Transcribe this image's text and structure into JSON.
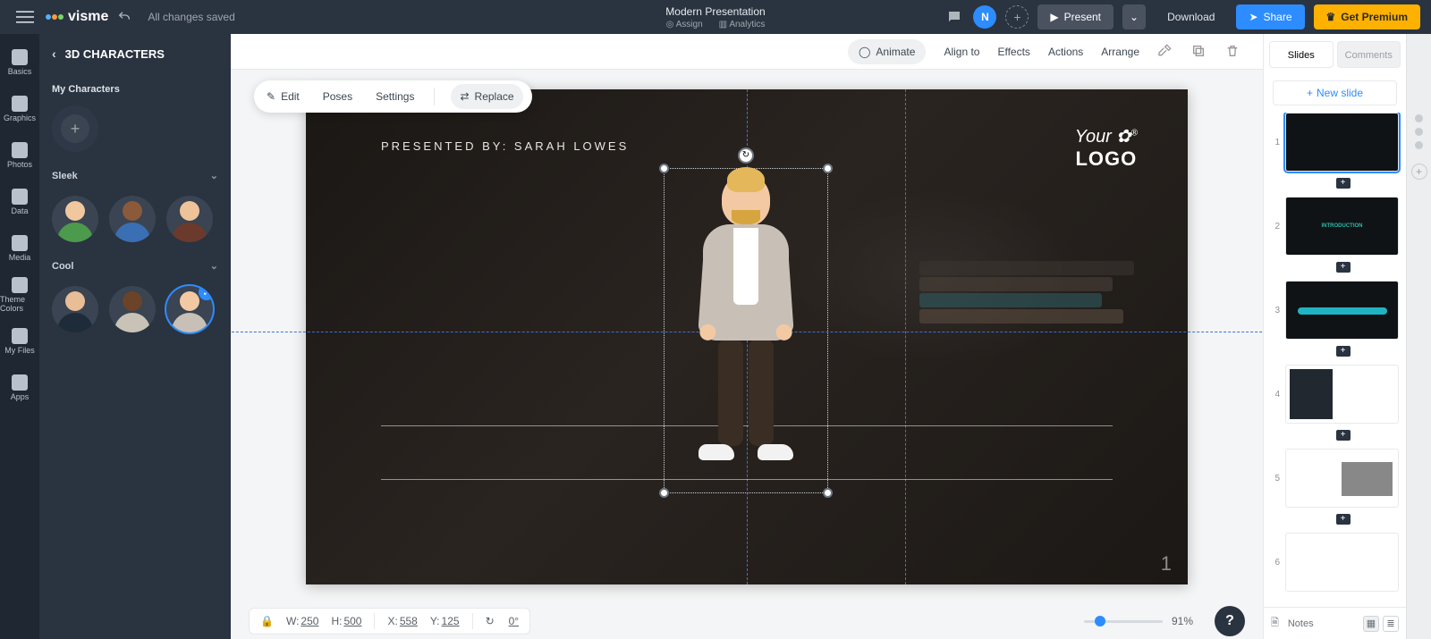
{
  "top": {
    "product": "visme",
    "status": "All changes saved",
    "title": "Modern Presentation",
    "assign": "Assign",
    "analytics": "Analytics",
    "user_initial": "N",
    "present": "Present",
    "download": "Download",
    "share": "Share",
    "premium": "Get Premium"
  },
  "rail": {
    "items": [
      "Basics",
      "Graphics",
      "Photos",
      "Data",
      "Media",
      "Theme Colors",
      "My Files",
      "Apps"
    ]
  },
  "panel": {
    "title": "3D CHARACTERS",
    "my": "My Characters",
    "sleek": "Sleek",
    "cool": "Cool"
  },
  "objbar": {
    "animate": "Animate",
    "alignto": "Align to",
    "effects": "Effects",
    "actions": "Actions",
    "arrange": "Arrange"
  },
  "float": {
    "edit": "Edit",
    "poses": "Poses",
    "settings": "Settings",
    "replace": "Replace"
  },
  "slide": {
    "presented": "PRESENTED BY: SARAH LOWES",
    "logo_top": "Your",
    "logo_bot": "LOGO",
    "number": "1"
  },
  "status": {
    "W_label": "W:",
    "W_val": "250",
    "H_label": "H:",
    "H_val": "500",
    "X_label": "X:",
    "X_val": "558",
    "Y_label": "Y:",
    "Y_val": "125",
    "R_val": "0°",
    "zoom": "91%"
  },
  "right": {
    "tab_slides": "Slides",
    "tab_comments": "Comments",
    "newslide": "New slide",
    "slides": [
      "1",
      "2",
      "3",
      "4",
      "5",
      "6"
    ],
    "notes": "Notes"
  }
}
